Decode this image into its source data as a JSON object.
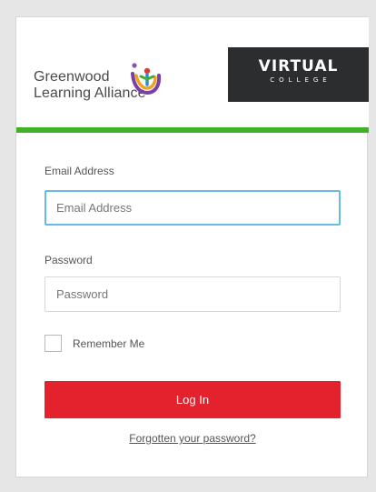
{
  "branding": {
    "org_line1": "Greenwood",
    "org_line2": "Learning Alliance",
    "partner_title": "VIRTUAL",
    "partner_subtitle": "COLLEGE"
  },
  "login": {
    "email_label": "Email Address",
    "email_placeholder": "Email Address",
    "password_label": "Password",
    "password_placeholder": "Password",
    "remember_label": "Remember Me",
    "submit_label": "Log In",
    "forgot_label": "Forgotten your password?"
  },
  "colors": {
    "accent_green": "#43b02a",
    "button_red": "#e4222e",
    "focus_blue": "#66bce8",
    "partner_bg": "#2c2d2f"
  }
}
